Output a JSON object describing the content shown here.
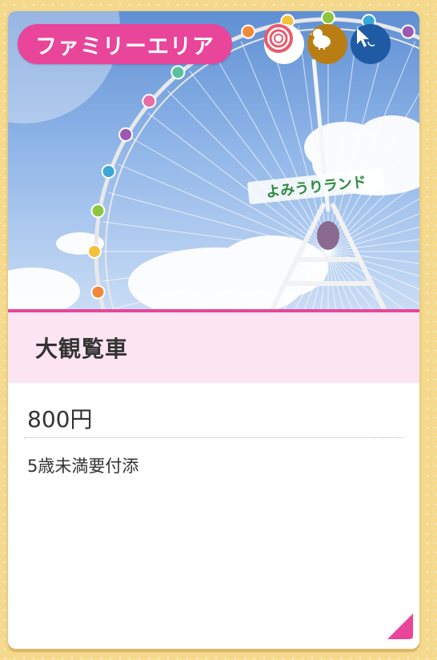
{
  "card": {
    "category": "ファミリーエリア",
    "title": "大観覧車",
    "price": "800円",
    "note": "5歳未満要付添",
    "photo_sign_text": "よみうりランド",
    "icons": [
      "target-icon",
      "chick-icon",
      "cursor-icon"
    ]
  },
  "colors": {
    "accent_pink": "#e8459b",
    "title_band": "#fde4f2",
    "background": "#f5d98d"
  }
}
